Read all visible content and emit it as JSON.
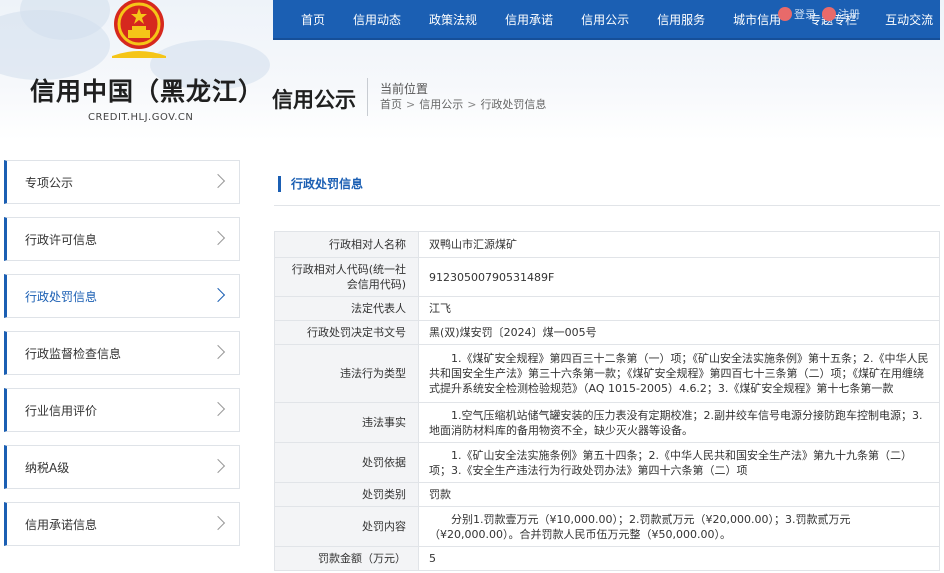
{
  "site": {
    "title": "信用中国（黑龙江）",
    "domain": "CREDIT.HLJ.GOV.CN",
    "section_title": "信用公示",
    "location_label": "当前位置",
    "breadcrumb": [
      "首页",
      "信用公示",
      "行政处罚信息"
    ]
  },
  "nav": {
    "items": [
      "首页",
      "信用动态",
      "政策法规",
      "信用承诺",
      "信用公示",
      "信用服务",
      "城市信用",
      "专题专栏",
      "互动交流"
    ],
    "tools": [
      "登录",
      "注册"
    ]
  },
  "sidebar": {
    "items": [
      {
        "label": "专项公示"
      },
      {
        "label": "行政许可信息"
      },
      {
        "label": "行政处罚信息"
      },
      {
        "label": "行政监督检查信息"
      },
      {
        "label": "行业信用评价"
      },
      {
        "label": "纳税A级"
      },
      {
        "label": "信用承诺信息"
      }
    ]
  },
  "content": {
    "heading": "行政处罚信息",
    "rows": [
      {
        "label": "行政相对人名称",
        "value": "双鸭山市汇源煤矿"
      },
      {
        "label": "行政相对人代码(统一社会信用代码)",
        "value": "91230500790531489F"
      },
      {
        "label": "法定代表人",
        "value": "江飞"
      },
      {
        "label": "行政处罚决定书文号",
        "value": "黑(双)煤安罚〔2024〕煤一005号"
      },
      {
        "label": "违法行为类型",
        "value": "1.《煤矿安全规程》第四百三十二条第（一）项；《矿山安全法实施条例》第十五条；2.《中华人民共和国安全生产法》第三十六条第一款；《煤矿安全规程》第四百七十三条第（二）项；《煤矿在用缠绕式提升系统安全检测检验规范》（AQ 1015-2005）4.6.2；3.《煤矿安全规程》第十七条第一款"
      },
      {
        "label": "违法事实",
        "value": "1.空气压缩机站储气罐安装的压力表没有定期校准；2.副井绞车信号电源分接防跑车控制电源；3.地面消防材料库的备用物资不全，缺少灭火器等设备。"
      },
      {
        "label": "处罚依据",
        "value": "1.《矿山安全法实施条例》第五十四条；2.《中华人民共和国安全生产法》第九十九条第（二）项；3.《安全生产违法行为行政处罚办法》第四十六条第（二）项"
      },
      {
        "label": "处罚类别",
        "value": "罚款"
      },
      {
        "label": "处罚内容",
        "value": "分别1.罚款壹万元（¥10,000.00）；2.罚款贰万元（¥20,000.00）；3.罚款贰万元（¥20,000.00）。合并罚款人民币伍万元整（¥50,000.00）。"
      },
      {
        "label": "罚款金额（万元）",
        "value": "5"
      }
    ]
  },
  "colors": {
    "primary": "#1b5fb3",
    "emblem_red": "#d6281e",
    "emblem_gold": "#f5c518"
  }
}
